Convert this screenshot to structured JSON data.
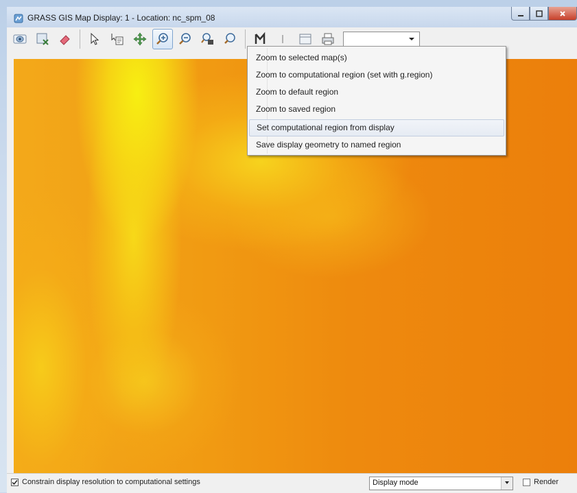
{
  "window": {
    "title": "GRASS GIS Map Display: 1 - Location: nc_spm_08"
  },
  "toolbar": {
    "tools": [
      {
        "name": "display-map-icon",
        "active": false
      },
      {
        "name": "render-map-icon",
        "active": false
      },
      {
        "name": "erase-icon",
        "active": false
      },
      {
        "name": "pointer-icon",
        "active": false
      },
      {
        "name": "query-icon",
        "active": false
      },
      {
        "name": "pan-icon",
        "active": false
      },
      {
        "name": "zoom-in-icon",
        "active": true
      },
      {
        "name": "zoom-out-icon",
        "active": false
      },
      {
        "name": "zoom-back-icon",
        "active": false
      },
      {
        "name": "zoom-menu-icon",
        "active": false
      },
      {
        "name": "analyze-icon",
        "active": false
      },
      {
        "name": "decoration-icon",
        "active": false
      },
      {
        "name": "save-icon",
        "active": false
      },
      {
        "name": "print-icon",
        "active": false
      }
    ],
    "combo_value": ""
  },
  "zoom_menu": {
    "items": [
      "Zoom to selected map(s)",
      "Zoom to computational region (set with g.region)",
      "Zoom to default region",
      "Zoom to saved region",
      "Set computational region from display",
      "Save display geometry to named region"
    ],
    "hovered_index": 4
  },
  "statusbar": {
    "constrain_checked": true,
    "constrain_label": "Constrain display resolution to computational settings",
    "mode_value": "Display mode",
    "render_checked": false,
    "render_label": "Render"
  },
  "colors": {
    "accent": "#7ea4cf",
    "map_yellow": "#f7ef12",
    "map_orange": "#ee8a0e"
  }
}
